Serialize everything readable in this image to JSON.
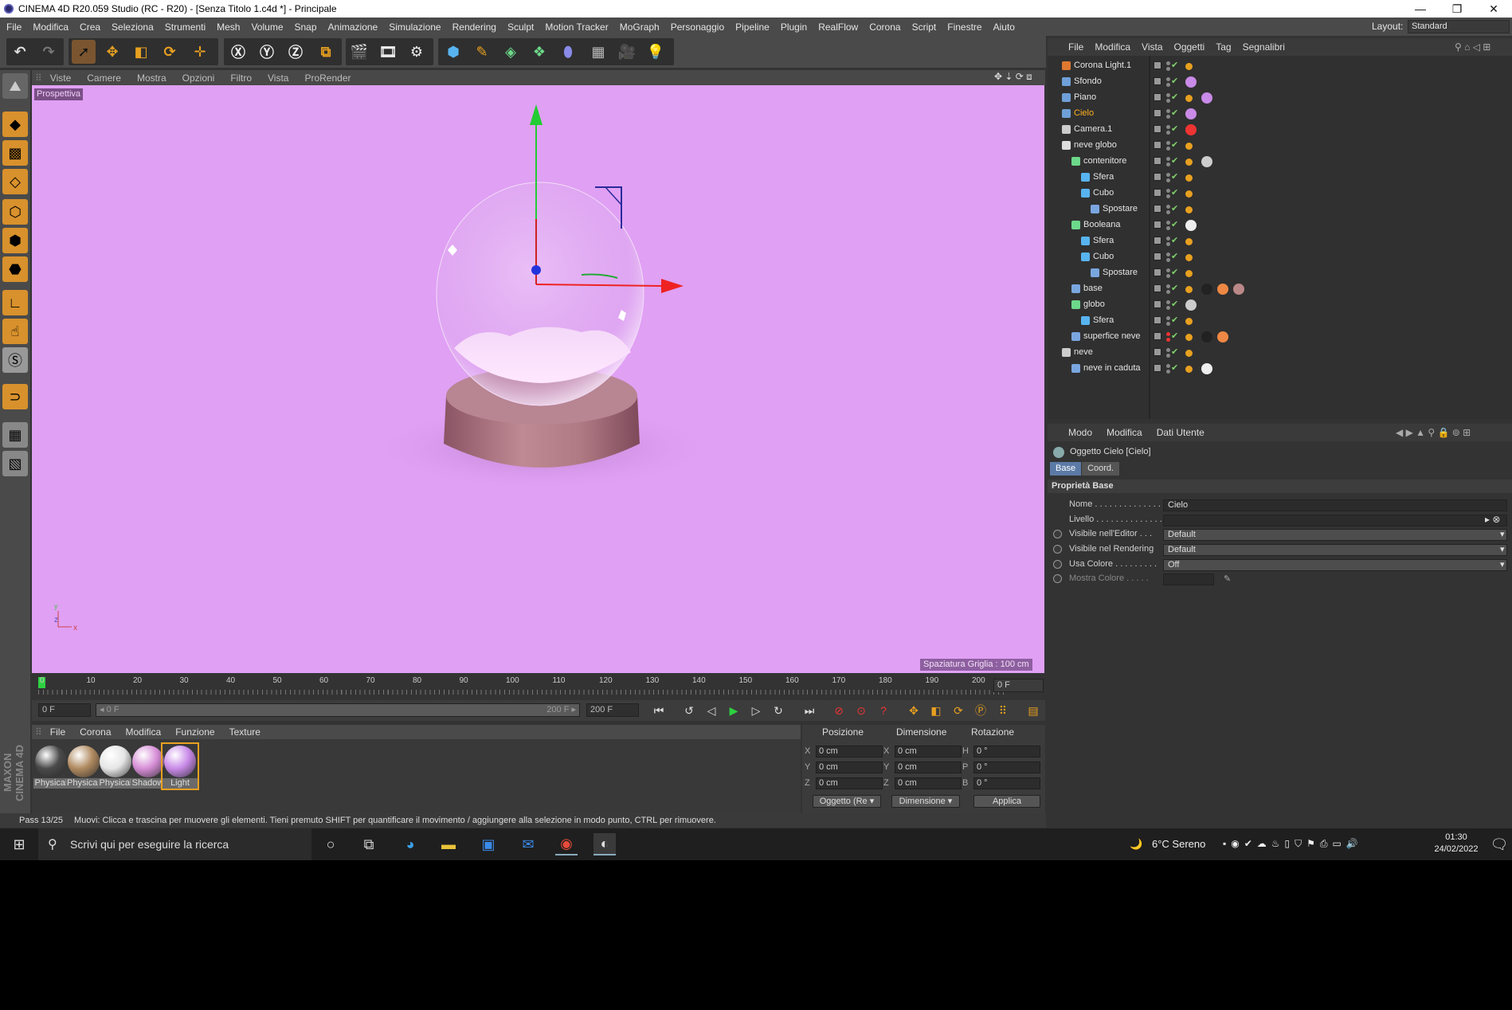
{
  "window": {
    "title": "CINEMA 4D R20.059 Studio (RC - R20) - [Senza Titolo 1.c4d *] - Principale",
    "minimize": "—",
    "restore": "❐",
    "close": "✕"
  },
  "menubar": {
    "items": [
      "File",
      "Modifica",
      "Crea",
      "Seleziona",
      "Strumenti",
      "Mesh",
      "Volume",
      "Snap",
      "Animazione",
      "Simulazione",
      "Rendering",
      "Sculpt",
      "Motion Tracker",
      "MoGraph",
      "Personaggio",
      "Pipeline",
      "Plugin",
      "RealFlow",
      "Corona",
      "Script",
      "Finestre",
      "Aiuto"
    ],
    "layout_label": "Layout:",
    "layout_value": "Standard"
  },
  "viewport": {
    "menu": [
      "Viste",
      "Camere",
      "Mostra",
      "Opzioni",
      "Filtro",
      "Vista",
      "ProRender"
    ],
    "view_name": "Prospettiva",
    "grid_spacing": "Spaziatura Griglia : 100 cm",
    "bg_color": "#e0a0f4"
  },
  "timeline": {
    "ticks": [
      "0",
      "10",
      "20",
      "30",
      "40",
      "50",
      "60",
      "70",
      "80",
      "90",
      "100",
      "110",
      "120",
      "130",
      "140",
      "150",
      "160",
      "170",
      "180",
      "190",
      "200"
    ],
    "current_frame": "0 F",
    "start_field": "0 F",
    "range_start": "0 F",
    "range_end": "200 F",
    "end_field": "200 F"
  },
  "materials": {
    "menu": [
      "File",
      "Corona",
      "Modifica",
      "Funzione",
      "Texture"
    ],
    "items": [
      {
        "label": "Physical",
        "color": "#4a4a4a"
      },
      {
        "label": "Physical",
        "color": "#b08a60"
      },
      {
        "label": "Physical",
        "color": "#e6e6e6"
      },
      {
        "label": "Shadow",
        "color": "#d68ed6"
      },
      {
        "label": "Light",
        "color": "#c98ae8"
      }
    ]
  },
  "coords": {
    "headers": [
      "Posizione",
      "Dimensione",
      "Rotazione"
    ],
    "rows": [
      {
        "a": "X",
        "pos": "0 cm",
        "b": "X",
        "dim": "0 cm",
        "c": "H",
        "rot": "0 °"
      },
      {
        "a": "Y",
        "pos": "0 cm",
        "b": "Y",
        "dim": "0 cm",
        "c": "P",
        "rot": "0 °"
      },
      {
        "a": "Z",
        "pos": "0 cm",
        "b": "Z",
        "dim": "0 cm",
        "c": "B",
        "rot": "0 °"
      }
    ],
    "mode1": "Oggetto (Re",
    "mode2": "Dimensione",
    "apply": "Applica"
  },
  "status": {
    "pass": "Pass 13/25",
    "message": "Muovi: Clicca e trascina per muovere gli elementi. Tieni premuto SHIFT per quantificare il movimento / aggiungere alla selezione in modo punto, CTRL per rimuovere."
  },
  "objects": {
    "menu": [
      "File",
      "Modifica",
      "Vista",
      "Oggetti",
      "Tag",
      "Segnalibri"
    ],
    "items": [
      {
        "name": "Corona Light.1",
        "icon": "#e07830",
        "hl": false
      },
      {
        "name": "Sfondo",
        "icon": "#6f9fd8",
        "hl": false
      },
      {
        "name": "Piano",
        "icon": "#6f9fd8",
        "hl": false
      },
      {
        "name": "Cielo",
        "icon": "#6f9fd8",
        "hl": true
      },
      {
        "name": "Camera.1",
        "icon": "#cccccc",
        "hl": false
      },
      {
        "name": "neve globo",
        "icon": "#dddddd",
        "hl": false
      },
      {
        "name": "contenitore",
        "icon": "#6cd88a",
        "hl": false
      },
      {
        "name": "Sfera",
        "icon": "#58b4f0",
        "hl": false
      },
      {
        "name": "Cubo",
        "icon": "#58b4f0",
        "hl": false
      },
      {
        "name": "Spostare",
        "icon": "#7aa6e0",
        "hl": false
      },
      {
        "name": "Booleana",
        "icon": "#6cd88a",
        "hl": false
      },
      {
        "name": "Sfera",
        "icon": "#58b4f0",
        "hl": false
      },
      {
        "name": "Cubo",
        "icon": "#58b4f0",
        "hl": false
      },
      {
        "name": "Spostare",
        "icon": "#7aa6e0",
        "hl": false
      },
      {
        "name": "base",
        "icon": "#7aa6e0",
        "hl": false
      },
      {
        "name": "globo",
        "icon": "#6cd88a",
        "hl": false
      },
      {
        "name": "Sfera",
        "icon": "#58b4f0",
        "hl": false
      },
      {
        "name": "superfice neve",
        "icon": "#7aa6e0",
        "hl": false
      },
      {
        "name": "neve",
        "icon": "#cccccc",
        "hl": false
      },
      {
        "name": "neve in caduta",
        "icon": "#7aa6e0",
        "hl": false
      }
    ]
  },
  "attributes": {
    "menu": [
      "Modo",
      "Modifica",
      "Dati Utente"
    ],
    "title": "Oggetto Cielo [Cielo]",
    "tabs": [
      "Base",
      "Coord."
    ],
    "section": "Proprietà Base",
    "fields": [
      {
        "label": "Nome . . . . . . . . . . . . . .",
        "value": "Cielo"
      },
      {
        "label": "Livello . . . . . . . . . . . . . .",
        "value": ""
      },
      {
        "label": "Visibile nell'Editor . . .",
        "value": "Default"
      },
      {
        "label": "Visibile nel Rendering",
        "value": "Default"
      },
      {
        "label": "Usa Colore . . . . . . . . .",
        "value": "Off"
      },
      {
        "label": "Mostra Colore . . . . .",
        "value": ""
      }
    ]
  },
  "taskbar": {
    "search_placeholder": "Scrivi qui per eseguire la ricerca",
    "weather": "6°C  Sereno",
    "time": "01:30",
    "date": "24/02/2022"
  }
}
